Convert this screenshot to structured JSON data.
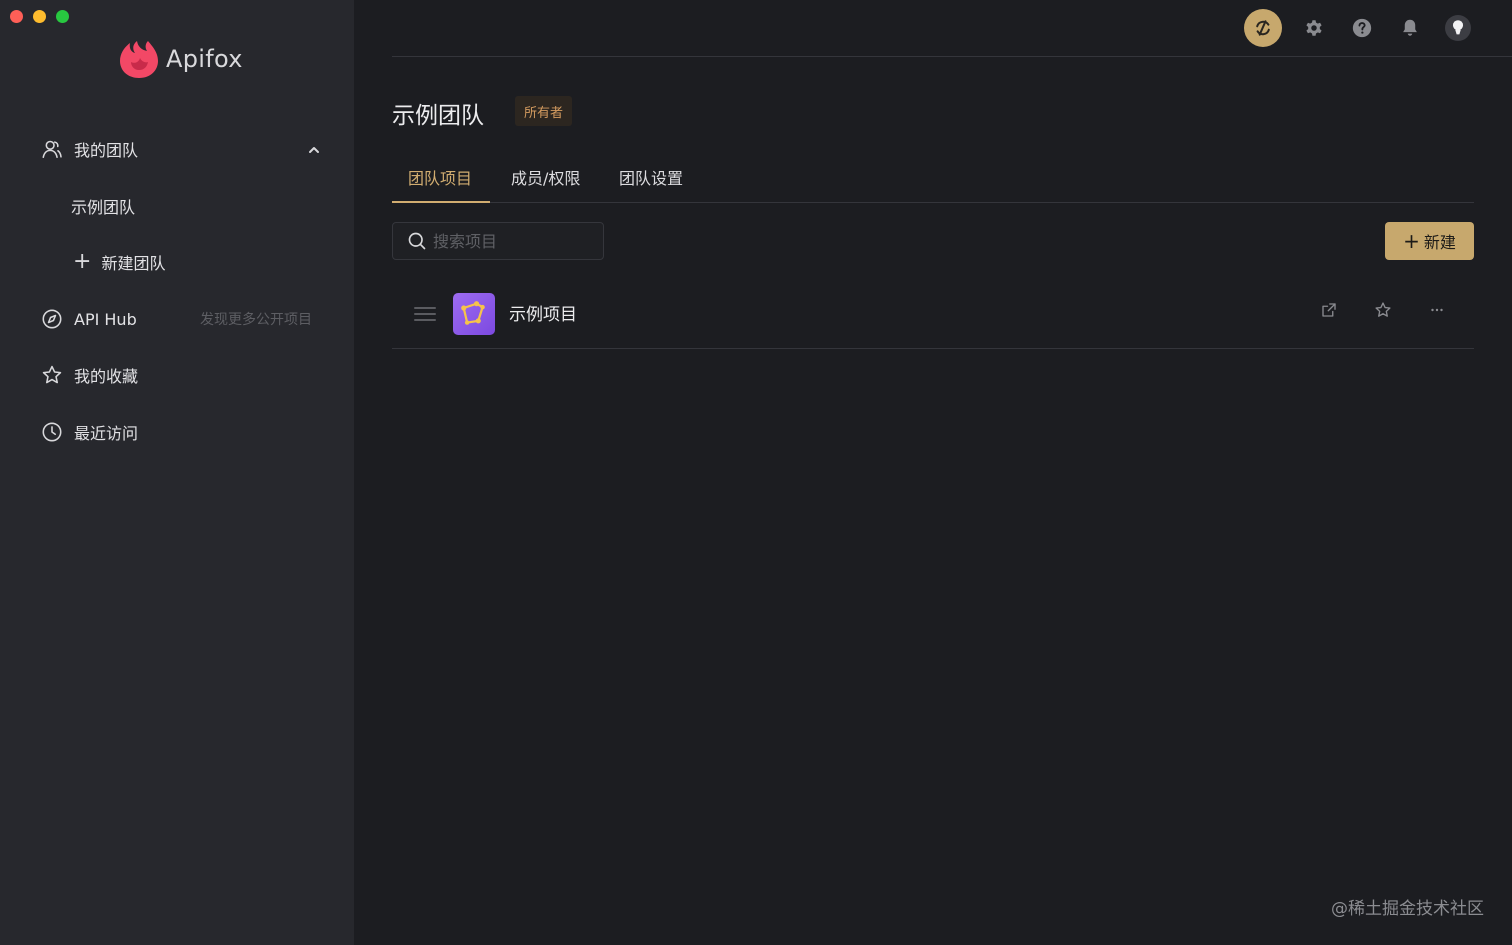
{
  "app": {
    "name": "Apifox"
  },
  "sidebar": {
    "my_team": "我的团队",
    "team_example": "示例团队",
    "new_team": "新建团队",
    "api_hub": "API Hub",
    "api_hub_hint": "发现更多公开项目",
    "favorites": "我的收藏",
    "recent": "最近访问"
  },
  "header": {
    "team_title": "示例团队",
    "role_badge": "所有者"
  },
  "tabs": [
    {
      "label": "团队项目",
      "active": true
    },
    {
      "label": "成员/权限",
      "active": false
    },
    {
      "label": "团队设置",
      "active": false
    }
  ],
  "search": {
    "placeholder": "搜索项目",
    "value": ""
  },
  "new_button": {
    "label": "新建"
  },
  "projects": [
    {
      "name": "示例项目"
    }
  ],
  "watermark": "@稀土掘金技术社区",
  "colors": {
    "accent": "#c7a86d",
    "active_tab": "#d1ad71",
    "badge_text": "#d39b5f",
    "brand": "#f24866",
    "project_icon": "#8b5cf6"
  },
  "icons": {
    "sync": "sync-icon",
    "settings": "gear-icon",
    "help": "help-icon",
    "notifications": "bell-icon",
    "avatar": "avatar-icon"
  }
}
